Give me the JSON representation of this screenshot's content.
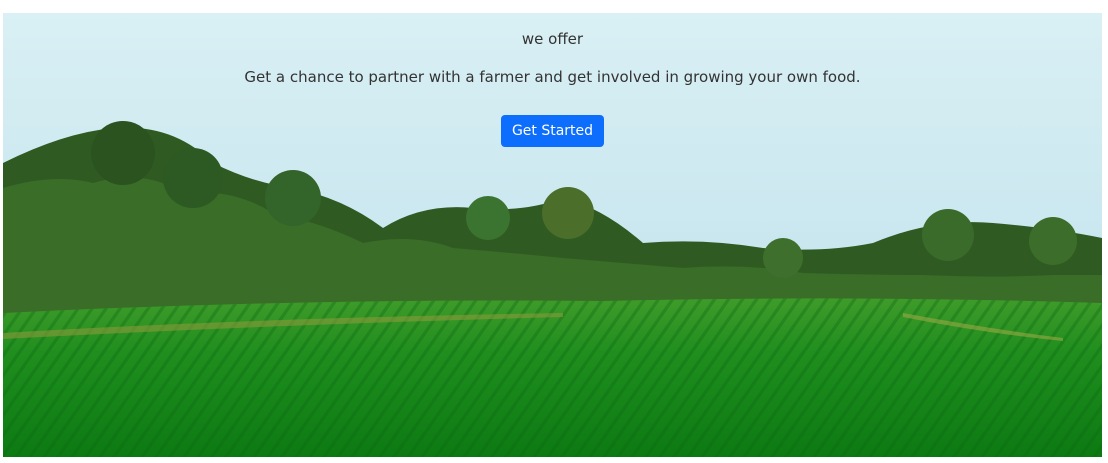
{
  "hero": {
    "eyebrow": "we offer",
    "tagline": "Get a chance to partner with a farmer and get involved in growing your own food.",
    "cta_label": "Get Started"
  },
  "colors": {
    "cta_background": "#0d6efd",
    "cta_text": "#ffffff",
    "body_text": "#333333"
  }
}
